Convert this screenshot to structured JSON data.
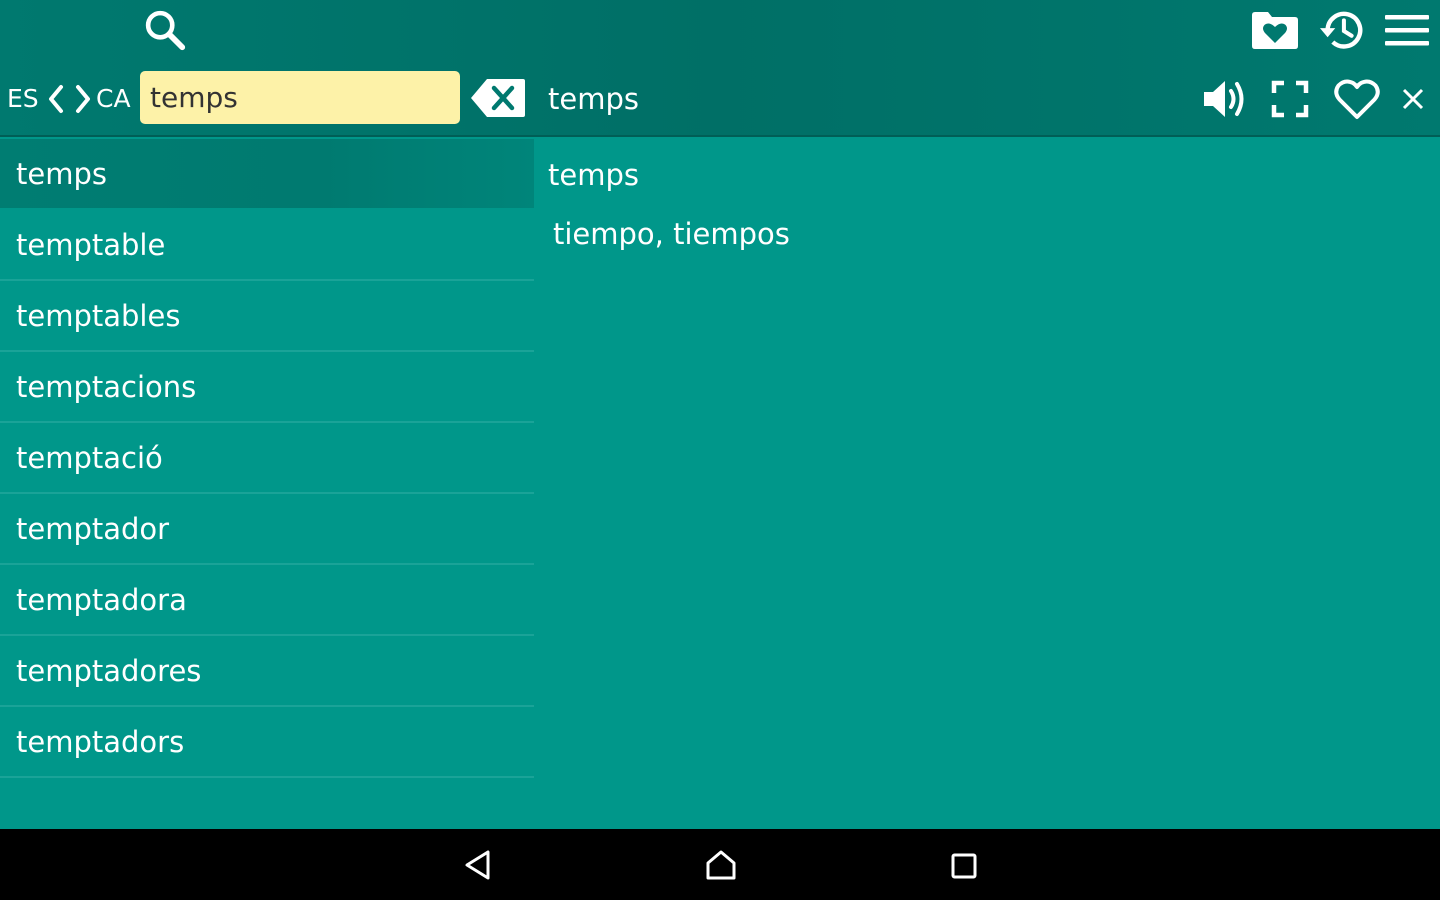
{
  "header": {
    "lang_from": "ES",
    "lang_to": "CA",
    "search_value": "temps",
    "current_word": "temps",
    "icons": {
      "search": "search-icon",
      "favorites_folder": "favorites-folder-icon",
      "history": "history-icon",
      "menu": "menu-icon",
      "swap_prev": "chevron-left-icon",
      "swap_next": "chevron-right-icon",
      "clear": "backspace-clear-icon",
      "speak": "speaker-icon",
      "fullscreen": "fullscreen-icon",
      "favorite": "heart-icon",
      "close": "close-icon"
    }
  },
  "word_list": [
    {
      "label": "temps",
      "selected": true
    },
    {
      "label": "temptable",
      "selected": false
    },
    {
      "label": "temptables",
      "selected": false
    },
    {
      "label": "temptacions",
      "selected": false
    },
    {
      "label": "temptació",
      "selected": false
    },
    {
      "label": "temptador",
      "selected": false
    },
    {
      "label": "temptadora",
      "selected": false
    },
    {
      "label": "temptadores",
      "selected": false
    },
    {
      "label": "temptadors",
      "selected": false
    }
  ],
  "detail": {
    "term": "temps",
    "translation": "tiempo, tiempos"
  },
  "navbar": {
    "icons": [
      "back-icon",
      "home-icon",
      "recents-icon"
    ]
  },
  "colors": {
    "background": "#00978a",
    "topbar": "#00796f",
    "search_field": "#fdf2a8",
    "navbar": "#000000"
  }
}
